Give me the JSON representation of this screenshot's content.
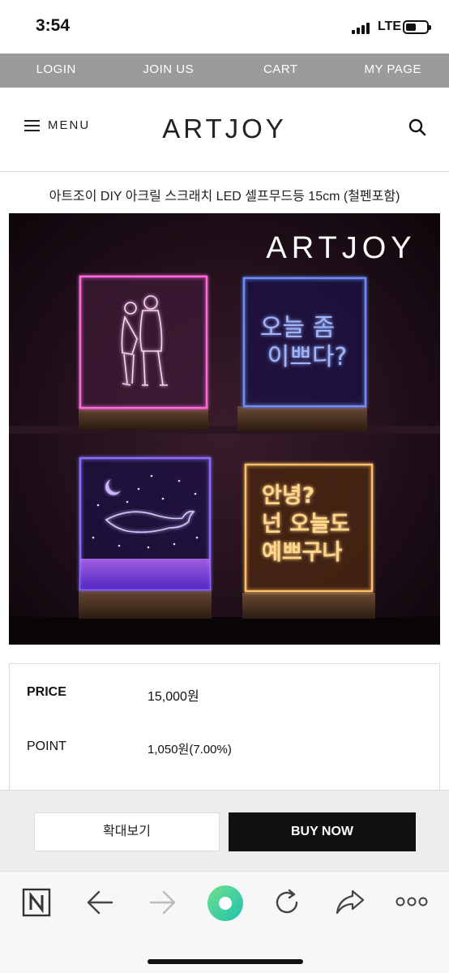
{
  "status": {
    "time": "3:54",
    "network": "LTE"
  },
  "topnav": [
    "LOGIN",
    "JOIN US",
    "CART",
    "MY PAGE"
  ],
  "header": {
    "menu_label": "MENU",
    "logo": "ARTJOY"
  },
  "product": {
    "title": "아트조이 DIY 아크릴 스크래치 LED 셀프무드등 15cm (철펜포함)",
    "image": {
      "brand": "ARTJOY",
      "panel2_text": [
        "오늘 좀",
        "이쁘다?"
      ],
      "panel4_text": [
        "안녕?",
        "넌 오늘도",
        "예쁘구나"
      ]
    },
    "price_label": "PRICE",
    "price_value": "15,000원",
    "point_label": "POINT",
    "point_value": "1,050원(7.00%)"
  },
  "actions": {
    "zoom_label": "확대보기",
    "buy_label": "BUY NOW"
  },
  "colors": {
    "nav_bg": "#9b9b9b",
    "buy_bg": "#111111",
    "refresh_accent": "#3ecf8e"
  },
  "browser_toolbar": [
    "naver-icon",
    "back-icon",
    "forward-icon",
    "green-dot-icon",
    "reload-icon",
    "share-icon",
    "more-icon"
  ]
}
